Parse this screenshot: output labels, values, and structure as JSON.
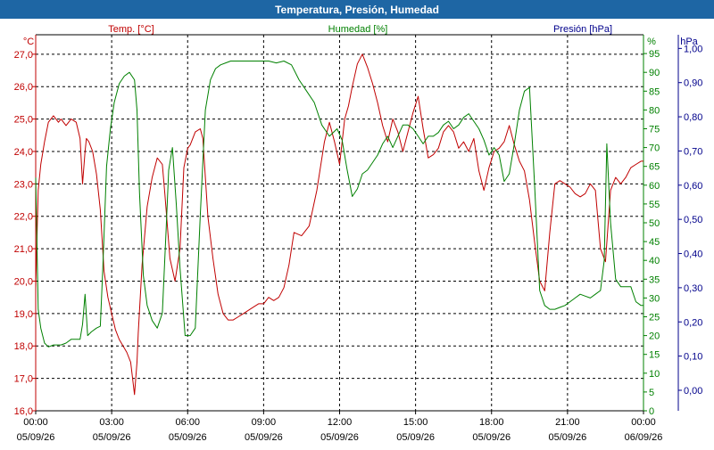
{
  "window": {
    "title": "Temperatura, Presión, Humedad"
  },
  "colors": {
    "temperature": "#c00000",
    "humidity": "#008000",
    "pressure": "#00008b",
    "title_bg": "#1e66a4",
    "grid": "#000000"
  },
  "chart_data": {
    "type": "line",
    "title": "Temperatura, Presión, Humedad",
    "grid": true,
    "x_axis": {
      "range": [
        "05/09/26 00:00",
        "06/09/26 00:00"
      ],
      "ticks": [
        {
          "time": "00:00",
          "date": "05/09/26"
        },
        {
          "time": "03:00",
          "date": "05/09/26"
        },
        {
          "time": "06:00",
          "date": "05/09/26"
        },
        {
          "time": "09:00",
          "date": "05/09/26"
        },
        {
          "time": "12:00",
          "date": "05/09/26"
        },
        {
          "time": "15:00",
          "date": "05/09/26"
        },
        {
          "time": "18:00",
          "date": "05/09/26"
        },
        {
          "time": "21:00",
          "date": "05/09/26"
        },
        {
          "time": "00:00",
          "date": "06/09/26"
        }
      ]
    },
    "axes": {
      "temperature": {
        "unit": "°C",
        "label": "Temp. [°C]",
        "range": [
          16,
          27.6
        ],
        "ticks": [
          "16,0",
          "17,0",
          "18,0",
          "19,0",
          "20,0",
          "21,0",
          "22,0",
          "23,0",
          "24,0",
          "25,0",
          "26,0",
          "27,0"
        ]
      },
      "humidity": {
        "unit": "%",
        "label": "Humedad [%]",
        "range": [
          0,
          100
        ],
        "ticks": [
          "0",
          "5",
          "10",
          "15",
          "20",
          "25",
          "30",
          "35",
          "40",
          "45",
          "50",
          "55",
          "60",
          "65",
          "70",
          "75",
          "80",
          "85",
          "90",
          "95"
        ]
      },
      "pressure": {
        "unit": "hPa",
        "label": "Presión [hPa]",
        "range": [
          -0.06,
          1.04
        ],
        "ticks": [
          "0,00",
          "0,10",
          "0,20",
          "0,30",
          "0,40",
          "0,50",
          "0,60",
          "0,70",
          "0,80",
          "0,90",
          "1,00"
        ]
      }
    },
    "series": [
      {
        "name": "Temp. [°C]",
        "axis": "temperature",
        "x_hours": [
          0,
          0.1,
          0.2,
          0.35,
          0.5,
          0.7,
          0.9,
          1.0,
          1.2,
          1.4,
          1.6,
          1.75,
          1.85,
          1.95,
          2.0,
          2.1,
          2.25,
          2.4,
          2.55,
          2.7,
          2.85,
          3.0,
          3.15,
          3.3,
          3.45,
          3.6,
          3.75,
          3.9,
          4.0,
          4.05,
          4.2,
          4.4,
          4.6,
          4.8,
          5.0,
          5.1,
          5.3,
          5.5,
          5.7,
          5.85,
          6.0,
          6.1,
          6.3,
          6.5,
          6.6,
          6.8,
          7.0,
          7.2,
          7.4,
          7.6,
          7.8,
          8.0,
          8.2,
          8.4,
          8.6,
          8.8,
          9.0,
          9.2,
          9.4,
          9.6,
          9.8,
          10.0,
          10.2,
          10.5,
          10.8,
          11.1,
          11.4,
          11.6,
          11.8,
          12.0,
          12.2,
          12.35,
          12.5,
          12.7,
          12.9,
          13.1,
          13.3,
          13.5,
          13.7,
          13.9,
          14.1,
          14.3,
          14.5,
          14.7,
          14.9,
          15.1,
          15.3,
          15.5,
          15.7,
          15.9,
          16.1,
          16.3,
          16.5,
          16.7,
          16.9,
          17.1,
          17.3,
          17.5,
          17.7,
          17.9,
          18.1,
          18.3,
          18.5,
          18.7,
          18.9,
          19.1,
          19.3,
          19.5,
          19.7,
          19.9,
          20.1,
          20.3,
          20.5,
          20.7,
          20.9,
          21.1,
          21.3,
          21.5,
          21.7,
          21.9,
          22.1,
          22.3,
          22.5,
          22.7,
          22.9,
          23.1,
          23.3,
          23.5,
          23.7,
          23.9,
          24.0
        ],
        "values": [
          19.8,
          22.8,
          23.6,
          24.3,
          24.9,
          25.1,
          24.9,
          25.0,
          24.8,
          25.0,
          24.9,
          24.4,
          23.0,
          24.0,
          24.4,
          24.3,
          24.0,
          23.3,
          22.2,
          20.3,
          19.5,
          19.0,
          18.5,
          18.2,
          18.0,
          17.8,
          17.5,
          16.5,
          17.5,
          18.4,
          20.5,
          22.3,
          23.2,
          23.8,
          23.6,
          22.7,
          20.7,
          20.0,
          21.0,
          23.5,
          24.1,
          24.2,
          24.6,
          24.7,
          24.4,
          22.0,
          20.7,
          19.6,
          19.0,
          18.8,
          18.8,
          18.9,
          19.0,
          19.1,
          19.2,
          19.3,
          19.3,
          19.5,
          19.4,
          19.5,
          19.8,
          20.5,
          21.5,
          21.4,
          21.7,
          22.8,
          24.3,
          24.9,
          24.3,
          23.6,
          25.0,
          25.4,
          26.0,
          26.7,
          27.0,
          26.6,
          26.1,
          25.5,
          24.8,
          24.3,
          25.0,
          24.6,
          24.0,
          24.6,
          25.2,
          25.7,
          24.7,
          23.8,
          23.9,
          24.1,
          24.6,
          24.8,
          24.6,
          24.1,
          24.3,
          24.0,
          24.4,
          23.4,
          22.8,
          23.5,
          24.0,
          24.1,
          24.3,
          24.8,
          24.2,
          23.7,
          23.4,
          22.5,
          21.2,
          20.0,
          19.7,
          21.5,
          23.0,
          23.1,
          23.0,
          22.9,
          22.7,
          22.6,
          22.7,
          23.0,
          22.8,
          21.0,
          20.6,
          22.8,
          23.2,
          23.0,
          23.2,
          23.5,
          23.6,
          23.7,
          23.7
        ]
      },
      {
        "name": "Humedad [%]",
        "axis": "humidity",
        "x_hours": [
          0,
          0.1,
          0.2,
          0.35,
          0.5,
          0.7,
          0.9,
          1.0,
          1.2,
          1.4,
          1.6,
          1.75,
          1.85,
          1.95,
          2.05,
          2.2,
          2.4,
          2.55,
          2.65,
          2.8,
          2.95,
          3.1,
          3.3,
          3.5,
          3.7,
          3.9,
          4.0,
          4.1,
          4.25,
          4.4,
          4.6,
          4.8,
          5.0,
          5.15,
          5.25,
          5.4,
          5.55,
          5.7,
          5.9,
          6.1,
          6.3,
          6.5,
          6.7,
          6.9,
          7.1,
          7.3,
          7.5,
          7.7,
          8.0,
          8.3,
          8.6,
          8.9,
          9.2,
          9.5,
          9.8,
          10.1,
          10.4,
          10.7,
          11.0,
          11.3,
          11.6,
          11.9,
          12.1,
          12.3,
          12.5,
          12.7,
          12.9,
          13.1,
          13.3,
          13.5,
          13.7,
          13.9,
          14.1,
          14.3,
          14.5,
          14.7,
          14.9,
          15.1,
          15.3,
          15.5,
          15.7,
          15.9,
          16.1,
          16.3,
          16.5,
          16.7,
          16.9,
          17.1,
          17.3,
          17.5,
          17.7,
          17.9,
          18.1,
          18.3,
          18.5,
          18.7,
          18.9,
          19.1,
          19.3,
          19.5,
          19.7,
          19.9,
          20.1,
          20.3,
          20.5,
          20.7,
          20.9,
          21.1,
          21.3,
          21.5,
          21.7,
          21.9,
          22.1,
          22.3,
          22.45,
          22.55,
          22.7,
          22.9,
          23.1,
          23.3,
          23.5,
          23.7,
          23.9,
          24.0
        ],
        "values": [
          62,
          27,
          22,
          18,
          17,
          17.5,
          17.5,
          17.5,
          18,
          19,
          19,
          19,
          23,
          31,
          20,
          21,
          22,
          22.5,
          38,
          65,
          75,
          82,
          87,
          89,
          90,
          88,
          80,
          58,
          36,
          28,
          24,
          22,
          26,
          48,
          64,
          70,
          55,
          38,
          20,
          20,
          22,
          52,
          80,
          88,
          91,
          92,
          92.5,
          93,
          93,
          93,
          93,
          93,
          93,
          92.5,
          93,
          92,
          88,
          85,
          82,
          76,
          73,
          75,
          72,
          64,
          57,
          59,
          63,
          64,
          66,
          68,
          71,
          73,
          70,
          73,
          76,
          76,
          75,
          73,
          71,
          73,
          73,
          74,
          76,
          77,
          75,
          76,
          78,
          79,
          77,
          75,
          72,
          68,
          70,
          68,
          61,
          63,
          71,
          80,
          85,
          86,
          60,
          32,
          28,
          27,
          27,
          27.5,
          28,
          29,
          30,
          31,
          30.5,
          30,
          31,
          32,
          40,
          71,
          50,
          35,
          33,
          33,
          33,
          29,
          28,
          28
        ]
      }
    ]
  }
}
